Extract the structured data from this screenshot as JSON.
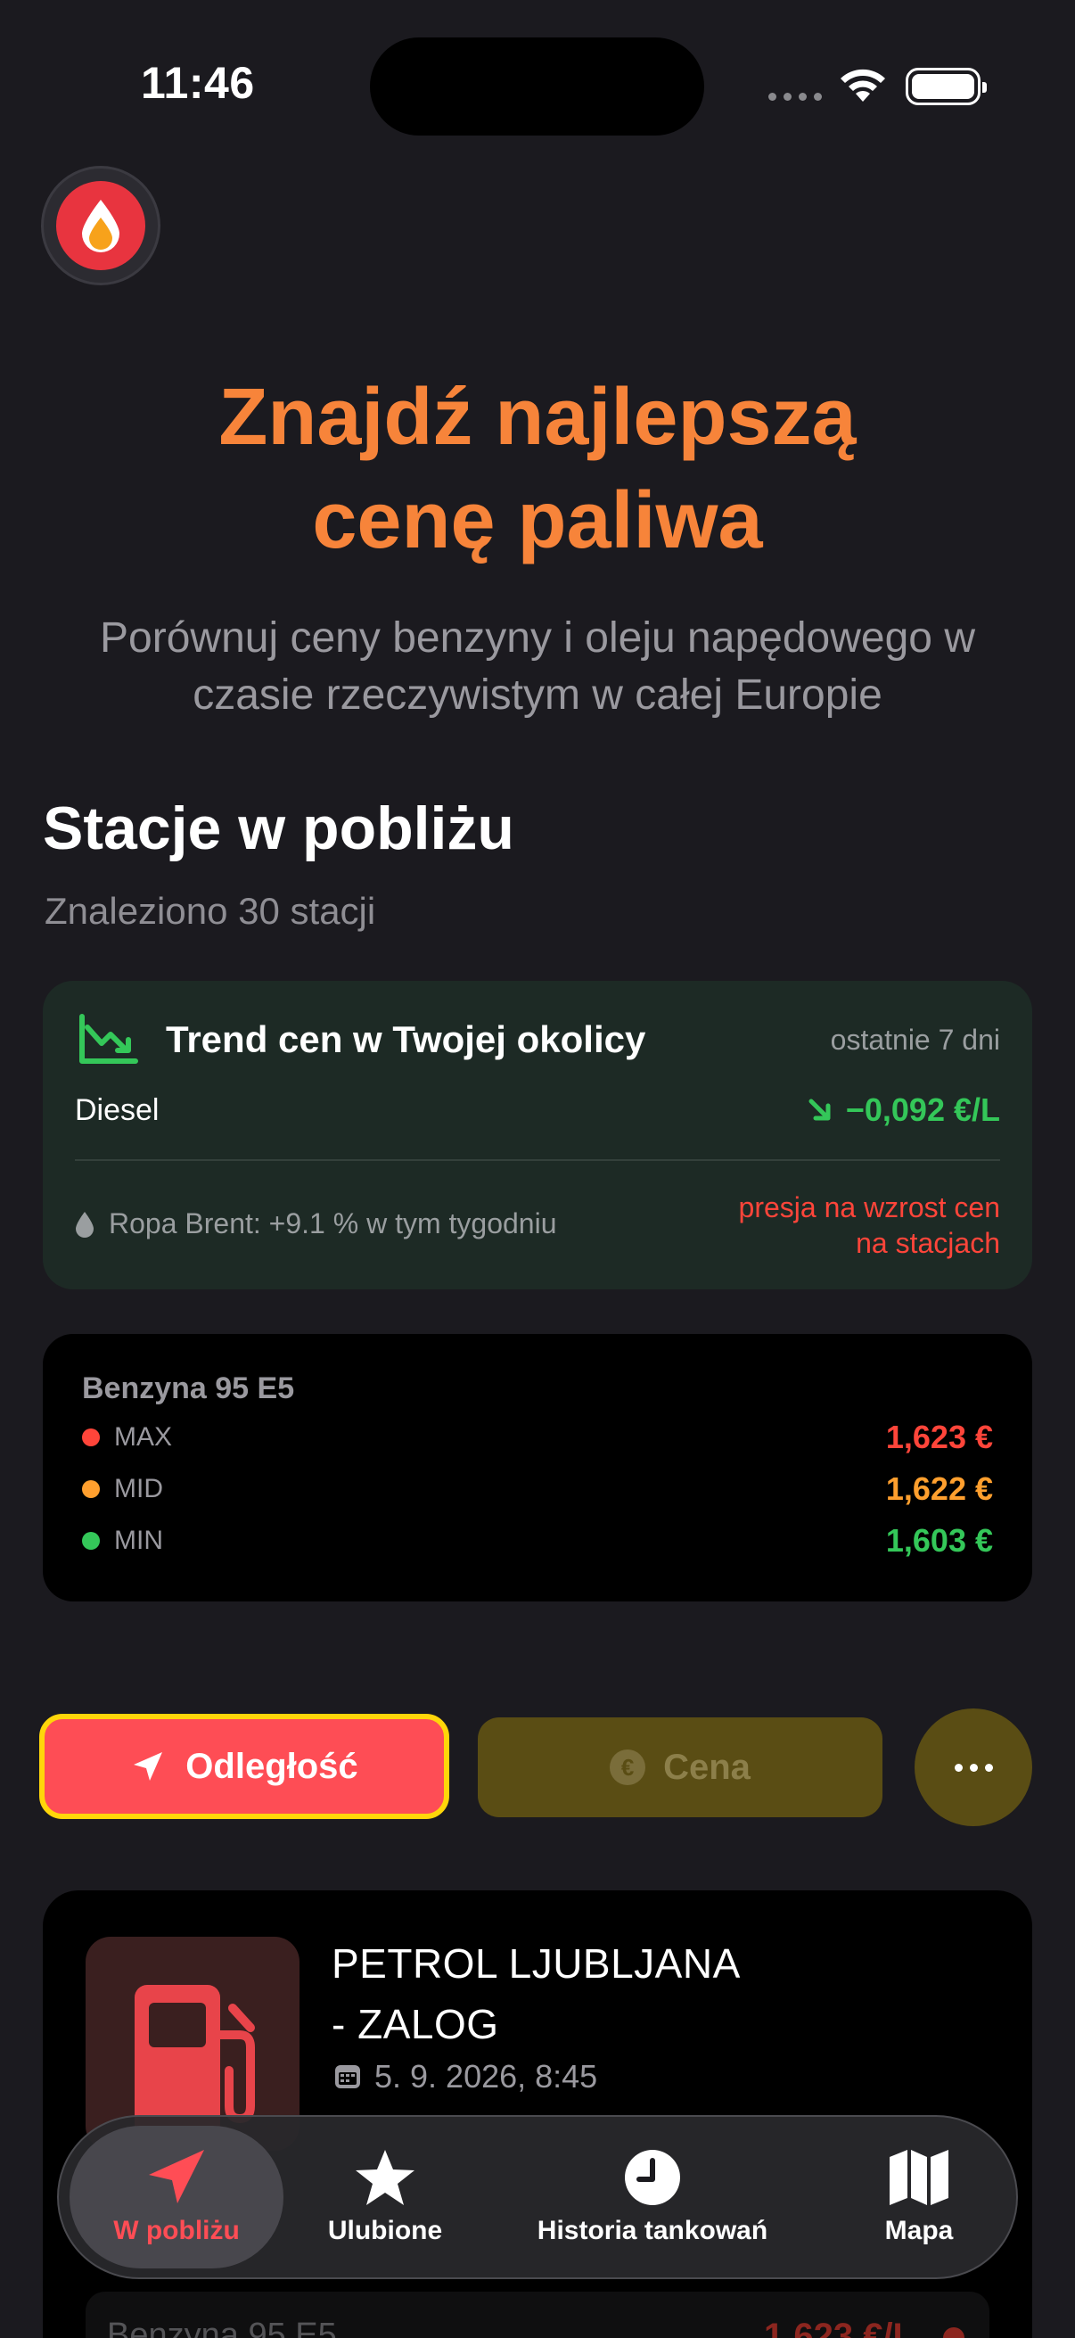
{
  "status_bar": {
    "time": "11:46"
  },
  "hero": {
    "title_line1": "Znajdź najlepszą",
    "title_line2": "cenę paliwa",
    "subtitle": "Porównuj ceny benzyny i oleju napędowego w czasie rzeczywistym w całej Europie"
  },
  "nearby": {
    "title": "Stacje w pobliżu",
    "count_text": "Znaleziono 30 stacji"
  },
  "trend": {
    "title": "Trend cen w Twojej okolicy",
    "period": "ostatnie 7 dni",
    "fuel": "Diesel",
    "change": "−0,092 €/L",
    "brent": "Ropa Brent: +9.1 % w tym tygodniu",
    "pressure_line1": "presja na wzrost cen",
    "pressure_line2": "na stacjach",
    "colors": {
      "down": "#34c759",
      "pressure": "#ff453a"
    }
  },
  "price_stats": {
    "fuel": "Benzyna 95 E5",
    "rows": [
      {
        "label": "MAX",
        "value": "1,623 €",
        "color": "#ff453a"
      },
      {
        "label": "MID",
        "value": "1,622 €",
        "color": "#ff9f2e"
      },
      {
        "label": "MIN",
        "value": "1,603 €",
        "color": "#34c759"
      }
    ]
  },
  "sort": {
    "distance_label": "Odległość",
    "price_label": "Cena",
    "more_icon": "ellipsis-icon"
  },
  "station": {
    "name_line1": "PETROL LJUBLJANA",
    "name_line2": "- ZALOG",
    "date": "5. 9. 2026, 8:45",
    "fuel": "Benzyna 95 E5",
    "price": "1,623 €/L"
  },
  "tabbar": {
    "tabs": [
      {
        "label": "W pobliżu",
        "icon": "location-arrow-icon",
        "active": true
      },
      {
        "label": "Ulubione",
        "icon": "star-icon",
        "active": false
      },
      {
        "label": "Historia tankowań",
        "icon": "clock-icon",
        "active": false
      },
      {
        "label": "Mapa",
        "icon": "map-icon",
        "active": false
      }
    ]
  }
}
